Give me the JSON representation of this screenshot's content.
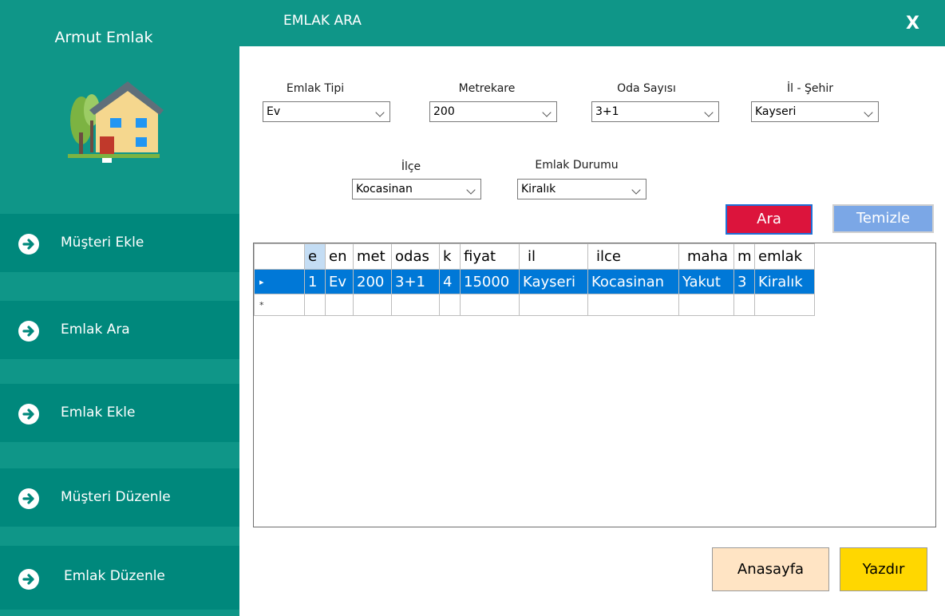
{
  "sidebar": {
    "brand": "Armut Emlak",
    "items": [
      {
        "label": "Müşteri Ekle"
      },
      {
        "label": "Emlak Ara"
      },
      {
        "label": "Emlak Ekle"
      },
      {
        "label": "Müşteri Düzenle"
      },
      {
        "label": "Emlak Düzenle"
      }
    ]
  },
  "header": {
    "title": "EMLAK ARA",
    "close": "X"
  },
  "filters": {
    "emlak_tipi": {
      "label": "Emlak Tipi",
      "value": "Ev"
    },
    "metrekare": {
      "label": "Metrekare",
      "value": "200"
    },
    "oda_sayisi": {
      "label": "Oda Sayısı",
      "value": "3+1"
    },
    "il": {
      "label": "İl - Şehir",
      "value": "Kayseri"
    },
    "ilce": {
      "label": "İlçe",
      "value": "Kocasinan"
    },
    "emlak_durumu": {
      "label": "Emlak Durumu",
      "value": "Kiralık"
    }
  },
  "buttons": {
    "ara": "Ara",
    "temizle": "Temizle",
    "anasayfa": "Anasayfa",
    "yazdir": "Yazdır"
  },
  "grid": {
    "headers": [
      "e",
      "en",
      "met",
      "odas",
      "k",
      "fiyat",
      "il",
      "ilce",
      "maha",
      "m",
      "emlak"
    ],
    "rows": [
      [
        "1",
        "Ev",
        "200",
        "3+1",
        "4",
        "15000",
        "Kayseri",
        "Kocasinan",
        "Yakut",
        "3",
        "Kiralık"
      ]
    ],
    "selected_row_marker": "▸",
    "new_row_marker": "*"
  },
  "colors": {
    "sidebar_bg": "#0f9688",
    "nav_item_bg": "#00887c",
    "ara_button": "#dc143c",
    "temizle_button": "#7ba7e6",
    "anasayfa_button": "#ffe4c4",
    "yazdir_button": "#ffd700",
    "selected_row": "#0078d7"
  },
  "icons": {
    "logo": "house-icon",
    "nav": "arrow-right-circle-icon",
    "close": "close-icon"
  }
}
